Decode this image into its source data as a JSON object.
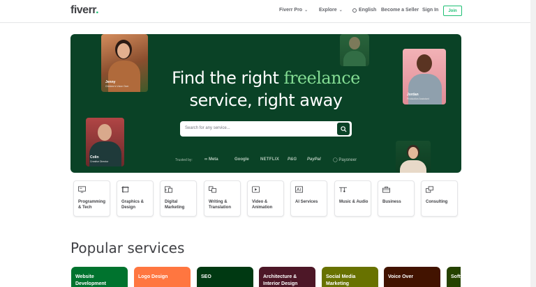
{
  "header": {
    "logo": "fiverr",
    "logo_dot": ".",
    "nav": {
      "fiverr_pro": "Fiverr Pro",
      "explore": "Explore",
      "language": "English",
      "become_seller": "Become a Seller",
      "sign_in": "Sign In",
      "join": "Join"
    }
  },
  "hero": {
    "title_line1_prefix": "Find the right ",
    "title_line1_accent": "freelance",
    "title_line2": "service, right away",
    "search_placeholder": "Search for any service...",
    "trusted_by": "Trusted by:",
    "brands": [
      "∞ Meta",
      "Google",
      "NETFLIX",
      "P&G",
      "PayPal",
      "Payoneer"
    ],
    "people": [
      {
        "name": "Jenny",
        "role": "Children's Voice Over"
      },
      {
        "name": "Colin",
        "role": "Creative Director"
      },
      {
        "name": "Jordan",
        "role": "Production Assistant"
      }
    ]
  },
  "categories": [
    {
      "label": "Programming & Tech",
      "icon": "monitor-code-icon"
    },
    {
      "label": "Graphics & Design",
      "icon": "design-frame-icon"
    },
    {
      "label": "Digital Marketing",
      "icon": "chart-phone-icon"
    },
    {
      "label": "Writing & Translation",
      "icon": "translate-icon"
    },
    {
      "label": "Video & Animation",
      "icon": "video-play-icon"
    },
    {
      "label": "AI Services",
      "icon": "ai-chip-icon"
    },
    {
      "label": "Music & Audio",
      "icon": "music-sliders-icon"
    },
    {
      "label": "Business",
      "icon": "briefcase-icon"
    },
    {
      "label": "Consulting",
      "icon": "consulting-icon"
    }
  ],
  "popular": {
    "heading": "Popular services",
    "services": [
      {
        "title": "Website Development",
        "color": "#00732e"
      },
      {
        "title": "Logo Design",
        "color": "#ff7640"
      },
      {
        "title": "SEO",
        "color": "#003912"
      },
      {
        "title": "Architecture & Interior Design",
        "color": "#4d1727"
      },
      {
        "title": "Social Media Marketing",
        "color": "#687200"
      },
      {
        "title": "Voice Over",
        "color": "#421300"
      },
      {
        "title": "Software Development",
        "color": "#254200"
      }
    ]
  },
  "colors": {
    "brand_green": "#1dbf73",
    "hero_bg": "#0a4226",
    "accent_text": "#83dc93"
  }
}
